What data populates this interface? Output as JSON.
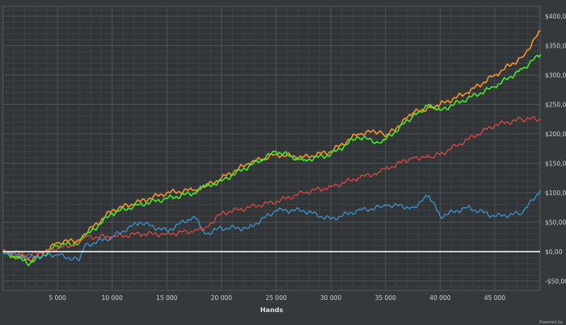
{
  "chart_data": {
    "type": "line",
    "title": "",
    "xlabel": "Hands",
    "ylabel": "",
    "xlim": [
      0,
      49200
    ],
    "ylim": [
      -65,
      415
    ],
    "grid": true,
    "legend": "none",
    "x_ticks": [
      5000,
      10000,
      15000,
      20000,
      25000,
      30000,
      35000,
      40000,
      45000
    ],
    "x_tick_labels": [
      "5 000",
      "10 000",
      "15 000",
      "20 000",
      "25 000",
      "30 000",
      "35 000",
      "40 000",
      "45 000"
    ],
    "y_ticks": [
      -50,
      0,
      50,
      100,
      150,
      200,
      250,
      300,
      350,
      400
    ],
    "y_tick_labels": [
      "-$50,00",
      "$0,00",
      "$50,00",
      "$100,00",
      "$150,00",
      "$200,00",
      "$250,00",
      "$300,00",
      "$350,00",
      "$400,00"
    ],
    "x": [
      0,
      2500,
      5000,
      7000,
      7500,
      10000,
      12500,
      15000,
      17500,
      18500,
      20000,
      22500,
      25000,
      27500,
      30000,
      32500,
      34500,
      35000,
      37500,
      39000,
      40000,
      42500,
      45000,
      47500,
      49200
    ],
    "series": [
      {
        "color": "#f7922a",
        "values": [
          0,
          -15,
          15,
          20,
          30,
          70,
          85,
          100,
          105,
          110,
          125,
          150,
          165,
          160,
          170,
          200,
          205,
          195,
          235,
          245,
          250,
          270,
          300,
          330,
          375
        ]
      },
      {
        "color": "#46e82a",
        "values": [
          0,
          -20,
          10,
          15,
          25,
          65,
          80,
          90,
          100,
          110,
          120,
          145,
          170,
          155,
          165,
          195,
          185,
          190,
          230,
          250,
          240,
          260,
          280,
          310,
          335
        ]
      },
      {
        "color": "#e8473f",
        "values": [
          0,
          -5,
          5,
          15,
          25,
          25,
          30,
          30,
          35,
          40,
          65,
          75,
          85,
          100,
          110,
          125,
          135,
          140,
          160,
          160,
          165,
          190,
          215,
          225,
          225
        ]
      },
      {
        "color": "#3a9ad9",
        "values": [
          0,
          -10,
          -5,
          -15,
          10,
          25,
          50,
          35,
          60,
          30,
          40,
          40,
          70,
          70,
          55,
          70,
          75,
          80,
          75,
          95,
          60,
          75,
          60,
          65,
          105
        ]
      }
    ],
    "zero_line_color": "#ffffff"
  },
  "footer": {
    "powered_by": "Powered by"
  }
}
